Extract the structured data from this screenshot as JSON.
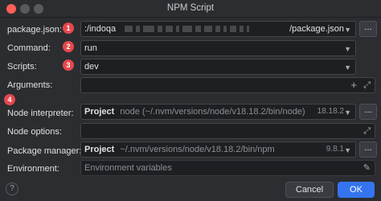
{
  "window": {
    "title": "NPM Script"
  },
  "badges": [
    "1",
    "2",
    "3",
    "4"
  ],
  "package_json": {
    "label": "package.json:",
    "value_prefix": ":/indoqa",
    "value_suffix": "/package.json",
    "browse_label": "..."
  },
  "command": {
    "label": "Command:",
    "value": "run"
  },
  "scripts": {
    "label": "Scripts:",
    "value": "dev"
  },
  "arguments": {
    "label": "Arguments:",
    "value": ""
  },
  "node_interpreter": {
    "label": "Node interpreter:",
    "name": "Project",
    "path": "node (~/.nvm/versions/node/v18.18.2/bin/node)",
    "version": "18.18.2",
    "browse_label": "..."
  },
  "node_options": {
    "label": "Node options:",
    "value": ""
  },
  "package_manager": {
    "label": "Package manager:",
    "name": "Project",
    "path": "~/.nvm/versions/node/v18.18.2/bin/npm",
    "version": "9.8.1",
    "browse_label": "..."
  },
  "environment": {
    "label": "Environment:",
    "placeholder": "Environment variables"
  },
  "buttons": {
    "help": "?",
    "cancel": "Cancel",
    "ok": "OK"
  },
  "icons": {
    "chevron": "chevron-down-icon",
    "expand": "expand-icon",
    "add": "plus-icon",
    "edit": "edit-icon"
  }
}
